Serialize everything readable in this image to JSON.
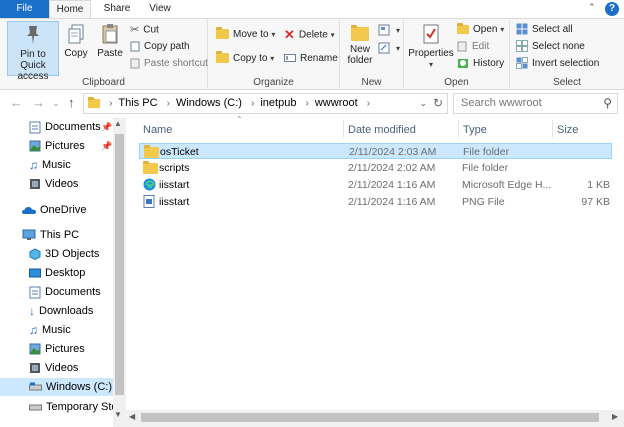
{
  "ribbon_tabs": {
    "file": "File",
    "home": "Home",
    "share": "Share",
    "view": "View"
  },
  "help": "?",
  "clipboard": {
    "label": "Clipboard",
    "pin_line1": "Pin to Quick",
    "pin_line2": "access",
    "copy": "Copy",
    "paste": "Paste",
    "cut": "Cut",
    "copy_path": "Copy path",
    "paste_shortcut": "Paste shortcut"
  },
  "organize": {
    "label": "Organize",
    "move_to": "Move to",
    "copy_to": "Copy to",
    "delete": "Delete",
    "rename": "Rename"
  },
  "new_group": {
    "label": "New",
    "new_folder_line1": "New",
    "new_folder_line2": "folder"
  },
  "open_group": {
    "label": "Open",
    "properties": "Properties",
    "open": "Open",
    "edit": "Edit",
    "history": "History"
  },
  "select_group": {
    "label": "Select",
    "select_all": "Select all",
    "select_none": "Select none",
    "invert_selection": "Invert selection"
  },
  "address": {
    "crumbs": [
      "This PC",
      "Windows (C:)",
      "inetpub",
      "wwwroot"
    ]
  },
  "search": {
    "placeholder": "Search wwwroot"
  },
  "nav_items": [
    {
      "label": "Documents",
      "icon": "documents-icon",
      "pinned": true
    },
    {
      "label": "Pictures",
      "icon": "pictures-icon",
      "pinned": true
    },
    {
      "label": "Music",
      "icon": "music-icon",
      "pinned": false
    },
    {
      "label": "Videos",
      "icon": "videos-icon",
      "pinned": false
    },
    {
      "label": "OneDrive",
      "icon": "onedrive-icon",
      "pinned": false
    },
    {
      "label": "This PC",
      "icon": "this-pc-icon",
      "pinned": false
    },
    {
      "label": "3D Objects",
      "icon": "3d-objects-icon",
      "pinned": false
    },
    {
      "label": "Desktop",
      "icon": "desktop-icon",
      "pinned": false
    },
    {
      "label": "Documents",
      "icon": "documents-icon",
      "pinned": false
    },
    {
      "label": "Downloads",
      "icon": "downloads-icon",
      "pinned": false
    },
    {
      "label": "Music",
      "icon": "music-icon",
      "pinned": false
    },
    {
      "label": "Pictures",
      "icon": "pictures-icon",
      "pinned": false
    },
    {
      "label": "Videos",
      "icon": "videos-icon",
      "pinned": false
    },
    {
      "label": "Windows (C:)",
      "icon": "drive-icon",
      "pinned": false
    },
    {
      "label": "Temporary Storage (D:)",
      "icon": "drive-icon",
      "pinned": false
    }
  ],
  "columns": {
    "name": "Name",
    "date": "Date modified",
    "type": "Type",
    "size": "Size"
  },
  "files": [
    {
      "name": "osTicket",
      "date": "2/11/2024 2:03 AM",
      "type": "File folder",
      "size": "",
      "icon": "folder-icon"
    },
    {
      "name": "scripts",
      "date": "2/11/2024 2:02 AM",
      "type": "File folder",
      "size": "",
      "icon": "folder-icon"
    },
    {
      "name": "iisstart",
      "date": "2/11/2024 1:16 AM",
      "type": "Microsoft Edge H...",
      "size": "1 KB",
      "icon": "edge-html-icon"
    },
    {
      "name": "iisstart",
      "date": "2/11/2024 1:16 AM",
      "type": "PNG File",
      "size": "97 KB",
      "icon": "png-file-icon"
    }
  ],
  "colors": {
    "accent": "#1a6fc9",
    "selection": "#cce8ff",
    "folder": "#f2c94c"
  }
}
